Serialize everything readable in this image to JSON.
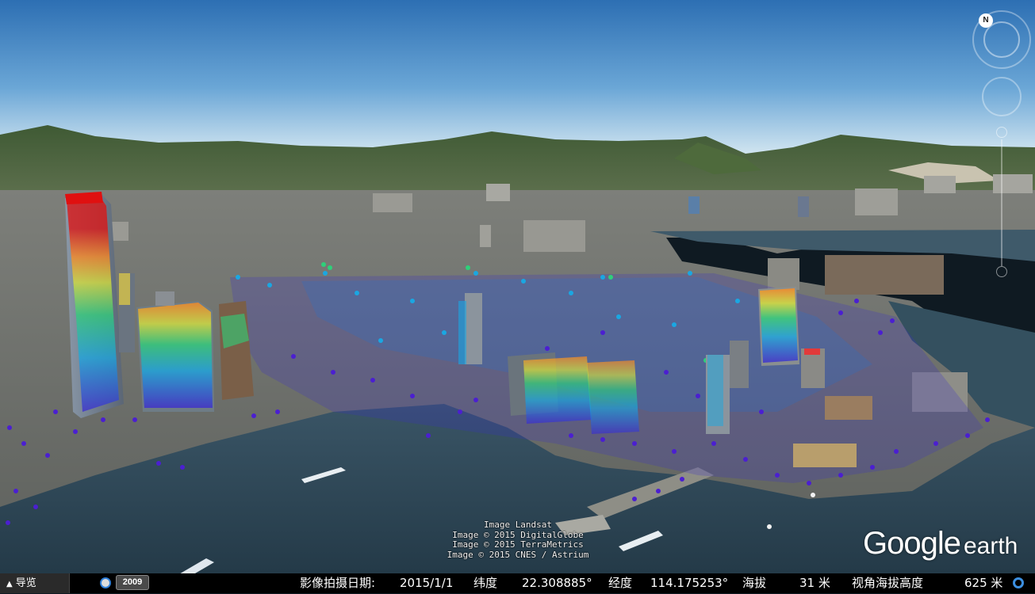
{
  "attribution": {
    "lines": [
      "Image Landsat",
      "Image © 2015 DigitalGlobe",
      "Image © 2015 TerraMetrics",
      "Image © 2015 CNES / Astrium"
    ]
  },
  "logo": {
    "google": "Google",
    "earth": "earth"
  },
  "compass": {
    "north": "N"
  },
  "statusbar": {
    "nav_label": "导览",
    "historical_year": "2009",
    "imagery_date_label": "影像拍摄日期:",
    "imagery_date": "2015/1/1",
    "lat_label": "纬度",
    "lat_value": "22.308885°",
    "lon_label": "经度",
    "lon_value": "114.175253°",
    "elev_label": "海拔",
    "elev_value": "31 米",
    "eye_label": "视角海拔高度",
    "eye_value": "625 米"
  },
  "colors": {
    "sky_top": "#2d6fb3",
    "sky_bottom": "#d6e8f2",
    "water": "#2f4657",
    "point_low": "#4b1fd1",
    "point_high": "#e01010"
  },
  "icons": [
    "compass-icon",
    "look-icon",
    "zoom-in-icon",
    "zoom-out-icon",
    "clock-icon",
    "loading-icon",
    "chevron-up-icon"
  ]
}
